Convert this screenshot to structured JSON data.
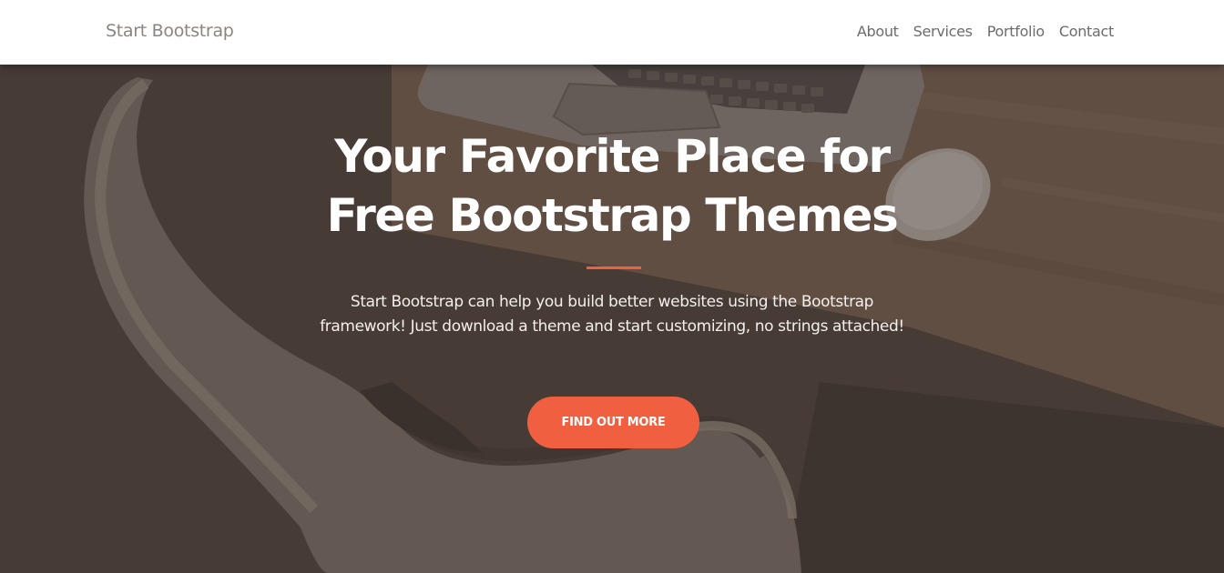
{
  "navbar": {
    "brand": "Start Bootstrap",
    "links": [
      {
        "label": "About"
      },
      {
        "label": "Services"
      },
      {
        "label": "Portfolio"
      },
      {
        "label": "Contact"
      }
    ]
  },
  "hero": {
    "headline_line1": "Your Favorite Place for",
    "headline_line2": "Free Bootstrap Themes",
    "lead_line1": "Start Bootstrap can help you build better websites using the Bootstrap",
    "lead_line2": "framework! Just download a theme and start customizing, no strings attached!",
    "cta_label": "Find Out More"
  },
  "colors": {
    "accent": "#f05f40",
    "navbar_bg": "#ffffff",
    "overlay": "#4a3e38"
  }
}
